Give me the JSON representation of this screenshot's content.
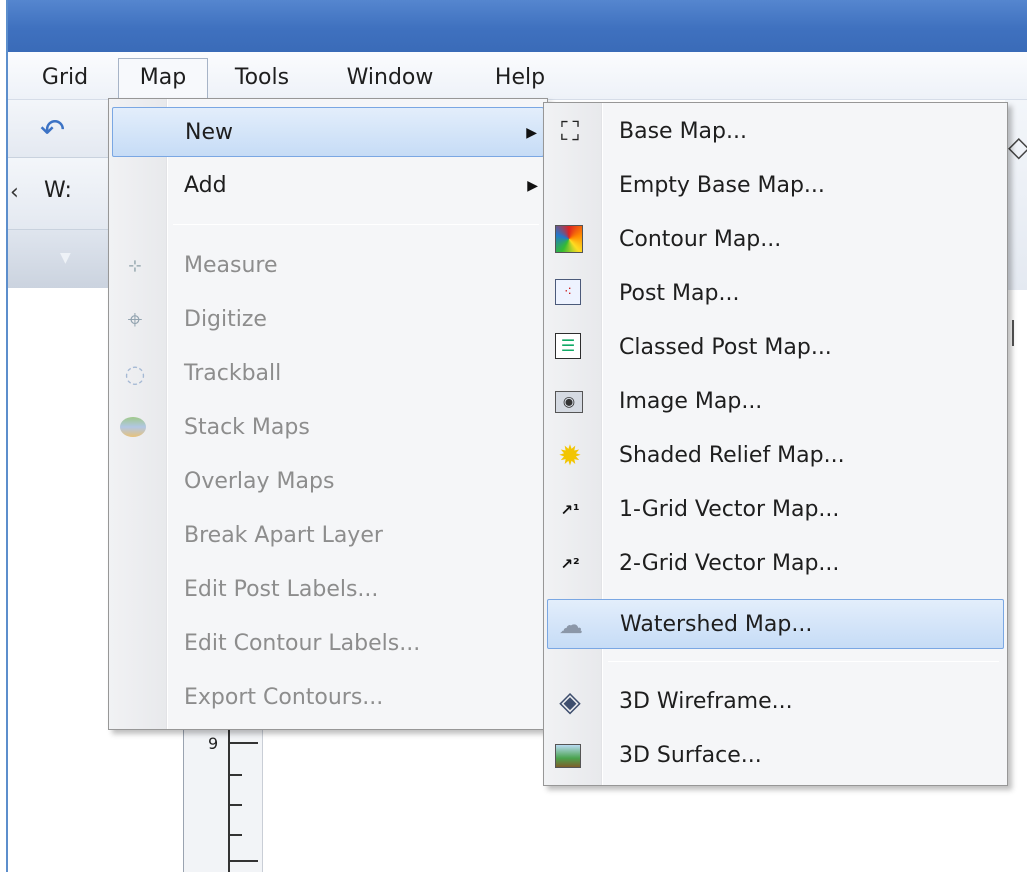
{
  "menubar": {
    "items": [
      {
        "label": "Grid"
      },
      {
        "label": "Map"
      },
      {
        "label": "Tools"
      },
      {
        "label": "Window"
      },
      {
        "label": "Help"
      }
    ]
  },
  "toolbar": {
    "w_label": "W:"
  },
  "ruler": {
    "number": "9"
  },
  "map_menu": {
    "items": [
      {
        "label": "New",
        "enabled": true,
        "submenu": true,
        "highlighted": true
      },
      {
        "label": "Add",
        "enabled": true,
        "submenu": true
      },
      {
        "label": "Measure",
        "enabled": false,
        "icon": "ruler-icon"
      },
      {
        "label": "Digitize",
        "enabled": false,
        "icon": "crosshair-icon"
      },
      {
        "label": "Trackball",
        "enabled": false,
        "icon": "trackball-icon"
      },
      {
        "label": "Stack Maps",
        "enabled": false,
        "icon": "stack-maps-icon"
      },
      {
        "label": "Overlay Maps",
        "enabled": false
      },
      {
        "label": "Break Apart Layer",
        "enabled": false
      },
      {
        "label": "Edit Post Labels...",
        "enabled": false
      },
      {
        "label": "Edit Contour Labels...",
        "enabled": false
      },
      {
        "label": "Export Contours...",
        "enabled": false
      }
    ]
  },
  "new_submenu": {
    "items": [
      {
        "label": "Base Map...",
        "icon": "base-map-icon"
      },
      {
        "label": "Empty Base Map..."
      },
      {
        "label": "Contour Map...",
        "icon": "contour-map-icon"
      },
      {
        "label": "Post Map...",
        "icon": "post-map-icon"
      },
      {
        "label": "Classed Post Map...",
        "icon": "classed-post-map-icon"
      },
      {
        "label": "Image Map...",
        "icon": "image-map-icon"
      },
      {
        "label": "Shaded Relief Map...",
        "icon": "shaded-relief-icon"
      },
      {
        "label": "1-Grid Vector Map...",
        "icon": "vector-1-icon"
      },
      {
        "label": "2-Grid Vector Map...",
        "icon": "vector-2-icon"
      },
      {
        "label": "Watershed Map...",
        "icon": "watershed-icon",
        "highlighted": true
      },
      {
        "label": "3D Wireframe...",
        "icon": "wireframe-icon"
      },
      {
        "label": "3D Surface...",
        "icon": "surface-icon"
      }
    ]
  },
  "colors": {
    "titlebar": "#4a7ac7",
    "highlight": "#c6dcf6",
    "highlight_border": "#7aa7e3",
    "disabled_text": "#8d8d8d"
  }
}
